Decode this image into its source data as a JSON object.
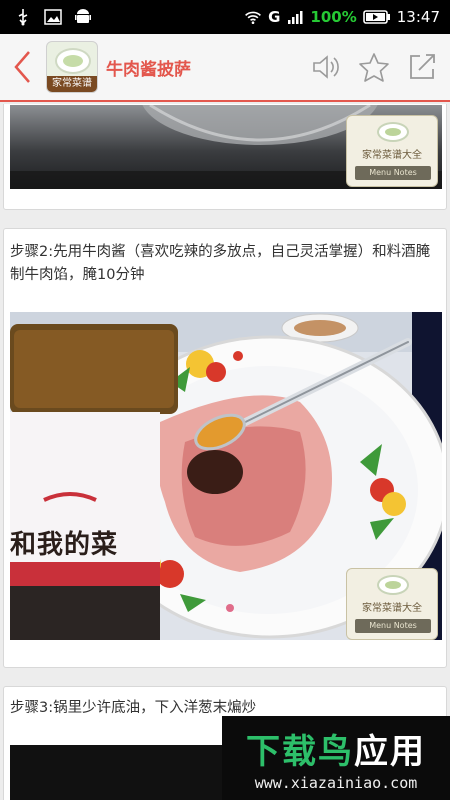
{
  "status_bar": {
    "network": "G",
    "battery_percent": "100%",
    "time": "13:47"
  },
  "header": {
    "thumb_label": "家常菜谱",
    "title": "牛肉酱披萨"
  },
  "watermark": {
    "title": "家常菜谱大全",
    "subtitle": "Menu Notes"
  },
  "steps": [
    {
      "text": "步骤2:先用牛肉酱（喜欢吃辣的多放点，自己灵活掌握）和料酒腌制牛肉馅，腌10分钟"
    },
    {
      "text": "步骤3:锅里少许底油，下入洋葱末煸炒"
    }
  ],
  "jar_label": "和我的菜",
  "ad": {
    "main_prefix": "下载鸟",
    "main_suffix": "应用",
    "url": "www.xiazainiao.com"
  },
  "colors": {
    "accent": "#e3574d",
    "battery": "#26c934"
  }
}
